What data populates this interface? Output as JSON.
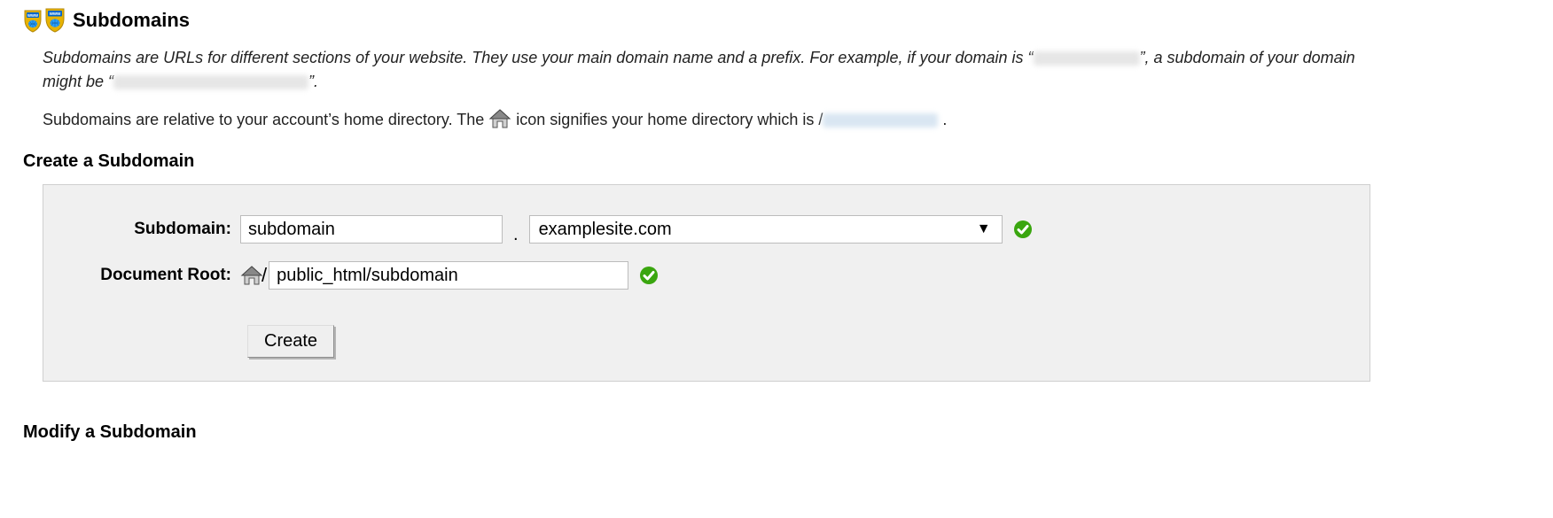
{
  "header": {
    "title": "Subdomains"
  },
  "description": {
    "line1_prefix": "Subdomains are URLs for different sections of your website. They use your main domain name and a prefix. For example, if your domain is “",
    "line1_mid": "”, a subdomain of your domain might be “",
    "line1_end": "”.",
    "line2_prefix": "Subdomains are relative to your account’s home directory. The ",
    "line2_mid": " icon signifies your home directory which is /",
    "line2_end": " ."
  },
  "sections": {
    "create_title": "Create a Subdomain",
    "modify_title": "Modify a Subdomain"
  },
  "form": {
    "subdomain_label": "Subdomain:",
    "subdomain_value": "subdomain",
    "dot": ".",
    "domain_selected": "examplesite.com",
    "document_root_label": "Document Root:",
    "slash": "/",
    "document_root_value": "public_html/subdomain",
    "create_button": "Create"
  }
}
